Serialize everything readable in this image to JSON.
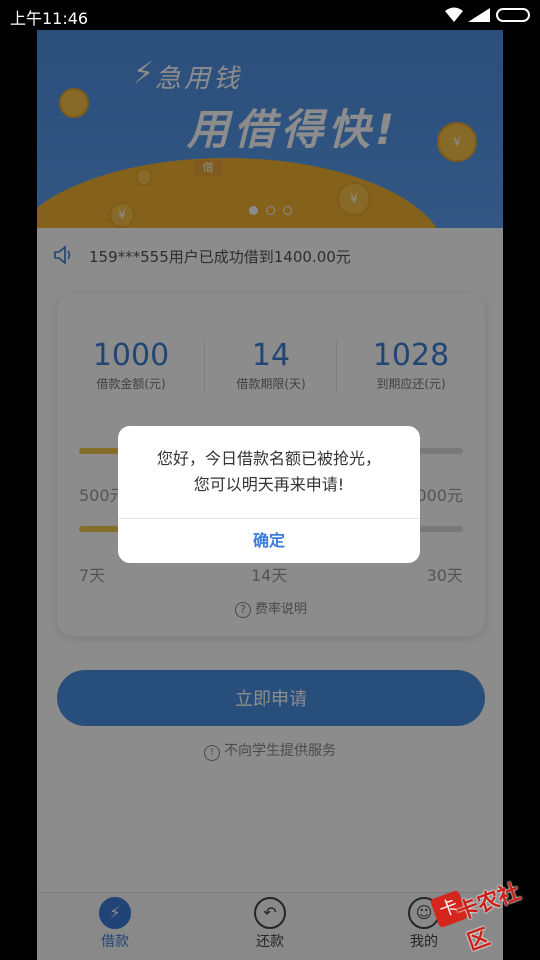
{
  "status": {
    "time": "上午11:46"
  },
  "banner": {
    "line1": "急用钱",
    "line2": "用借得快!",
    "coin_symbol": "¥",
    "flag_text": "借",
    "slides": [
      true,
      false,
      false
    ]
  },
  "notice": {
    "text": "159***555用户已成功借到1400.00元"
  },
  "stats": [
    {
      "value": "1000",
      "label": "借款金额(元)"
    },
    {
      "value": "14",
      "label": "借款期限(天)"
    },
    {
      "value": "1028",
      "label": "到期应还(元)"
    }
  ],
  "amount_slider": {
    "min_label": "500元",
    "max_label": "2000元",
    "level": 0.3
  },
  "term_slider": {
    "min_label": "7天",
    "mid_label": "14天",
    "max_label": "30天",
    "level": 0.3
  },
  "rate_link": "费率说明",
  "apply_button": "立即申请",
  "no_student": "不向学生提供服务",
  "tabs": [
    {
      "label": "借款",
      "icon": "lightning-icon"
    },
    {
      "label": "还款",
      "icon": "repay-icon"
    },
    {
      "label": "我的",
      "icon": "user-icon"
    }
  ],
  "dialog": {
    "line1": "您好，今日借款名额已被抢光，",
    "line2": "您可以明天再来申请!",
    "confirm": "确定"
  },
  "watermark": {
    "text": "卡农社区"
  },
  "colors": {
    "accent": "#3b7dd8",
    "banner": "#5a9bea",
    "hill": "#f2b233",
    "slider_fill": "#f0c84e"
  }
}
